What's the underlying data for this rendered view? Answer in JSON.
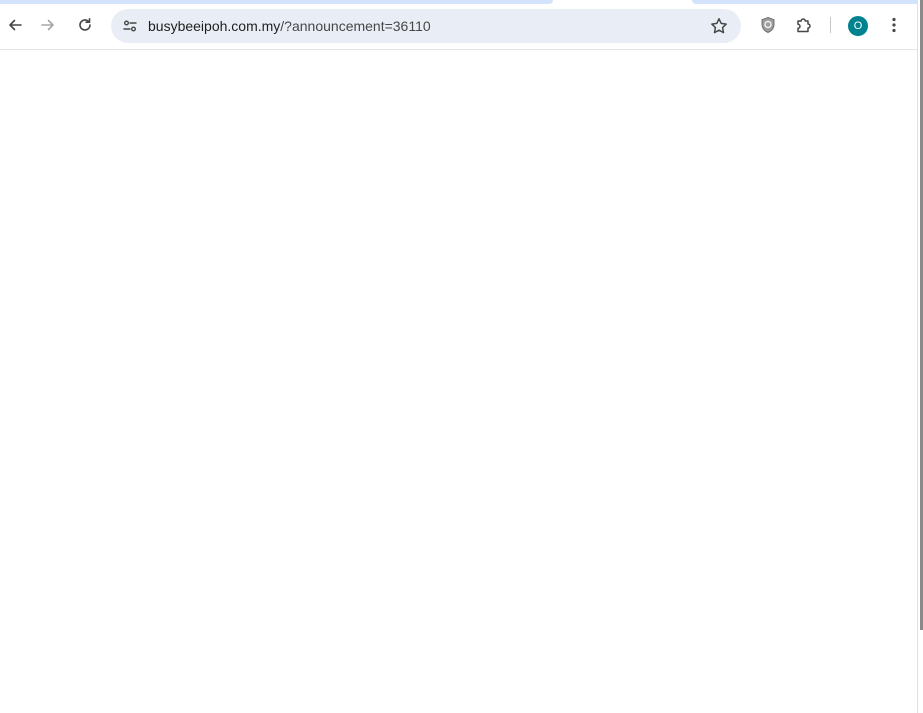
{
  "browser": {
    "address_bar": {
      "url_host": "busybeeipoh.com.my",
      "url_rest": "/?announcement=36110"
    },
    "profile": {
      "initial": "O",
      "color": "#00838f"
    },
    "icons": {
      "back": "arrow-left-icon",
      "forward": "arrow-right-icon",
      "reload": "reload-icon",
      "site_info": "tune-icon",
      "bookmark": "star-icon",
      "shield": "shield-icon",
      "extensions": "puzzle-icon",
      "menu": "more-vertical-icon"
    },
    "accent_color": "#d3e3fd",
    "omnibox_color": "#e9eef6"
  },
  "page": {
    "content": ""
  }
}
